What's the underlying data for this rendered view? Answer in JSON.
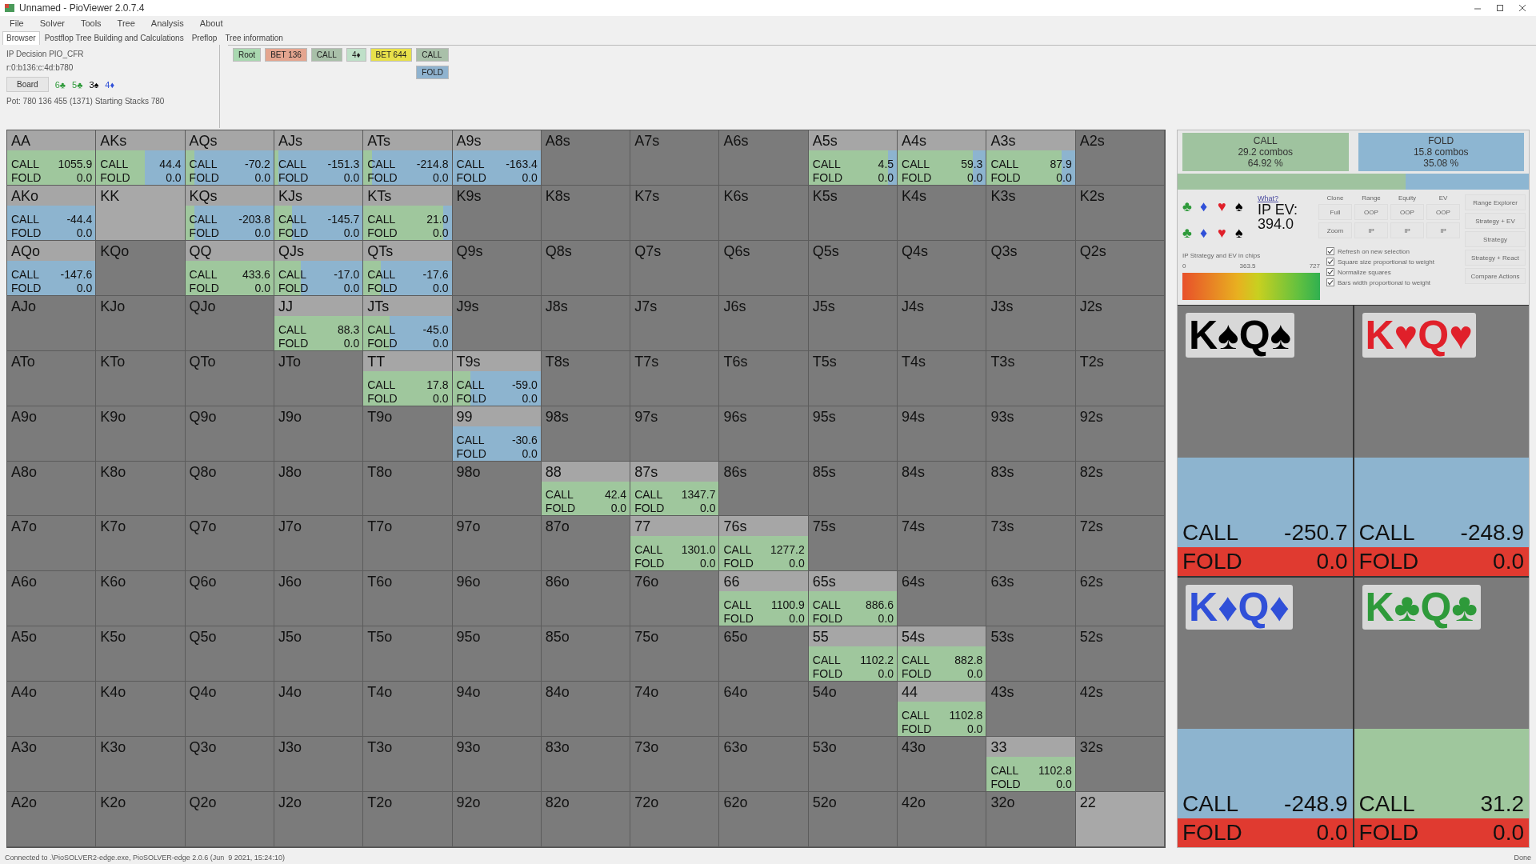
{
  "window": {
    "title": "Unnamed - PioViewer 2.0.7.4"
  },
  "menu": [
    "File",
    "Solver",
    "Tools",
    "Tree",
    "Analysis",
    "About"
  ],
  "tabs": [
    {
      "label": "Browser",
      "selected": true
    },
    {
      "label": "Postflop Tree Building and Calculations",
      "selected": false
    },
    {
      "label": "Preflop",
      "selected": false
    },
    {
      "label": "Tree information",
      "selected": false
    }
  ],
  "info": {
    "decision": "IP Decision   PIO_CFR",
    "line": "r:0:b136:c:4d:b780",
    "board_button": "Board",
    "board": [
      {
        "text": "6♣",
        "color": "#2e9a3a"
      },
      {
        "text": "5♣",
        "color": "#2e9a3a"
      },
      {
        "text": "3♠",
        "color": "#000000"
      },
      {
        "text": "4♦",
        "color": "#3050d8"
      }
    ],
    "pot": "Pot: 780 136 455 (1371) Starting Stacks 780"
  },
  "tree": {
    "path": [
      {
        "label": "Root",
        "color": "#a9d8b0"
      },
      {
        "label": "BET 136",
        "color": "#e4a58f"
      },
      {
        "label": "CALL",
        "color": "#a9c0a9"
      },
      {
        "label": "4♦",
        "color": "#bfe0c8"
      },
      {
        "label": "BET 644",
        "color": "#e8e04a"
      }
    ],
    "options": [
      {
        "label": "CALL",
        "color": "#a9c0a9"
      },
      {
        "label": "FOLD",
        "color": "#8fb3cf"
      }
    ]
  },
  "grid": [
    [
      {
        "kind": "strategy",
        "label": "AA",
        "call_label": "CALL",
        "call": "1055.9",
        "fold_label": "FOLD",
        "fold": "0.0",
        "level": 1
      },
      {
        "kind": "strategy",
        "label": "AKs",
        "call_label": "CALL",
        "call": "44.4",
        "fold_label": "FOLD",
        "fold": "0.0",
        "level": 0.55
      },
      {
        "kind": "strategy",
        "label": "AQs",
        "call_label": "CALL",
        "call": "-70.2",
        "fold_label": "FOLD",
        "fold": "0.0",
        "level": 0.1
      },
      {
        "kind": "strategy",
        "label": "AJs",
        "call_label": "CALL",
        "call": "-151.3",
        "fold_label": "FOLD",
        "fold": "0.0",
        "level": 0.05
      },
      {
        "kind": "strategy",
        "label": "ATs",
        "call_label": "CALL",
        "call": "-214.8",
        "fold_label": "FOLD",
        "fold": "0.0",
        "level": 0.1
      },
      {
        "kind": "strategy",
        "label": "A9s",
        "call_label": "CALL",
        "call": "-163.4",
        "fold_label": "FOLD",
        "fold": "0.0",
        "level": 0
      },
      {
        "kind": "empty",
        "label": "A8s"
      },
      {
        "kind": "empty",
        "label": "A7s"
      },
      {
        "kind": "empty",
        "label": "A6s"
      },
      {
        "kind": "strategy",
        "label": "A5s",
        "call_label": "CALL",
        "call": "4.5",
        "fold_label": "FOLD",
        "fold": "0.0",
        "level": 0.9
      },
      {
        "kind": "strategy",
        "label": "A4s",
        "call_label": "CALL",
        "call": "59.3",
        "fold_label": "FOLD",
        "fold": "0.0",
        "level": 0.85
      },
      {
        "kind": "strategy",
        "label": "A3s",
        "call_label": "CALL",
        "call": "87.9",
        "fold_label": "FOLD",
        "fold": "0.0",
        "level": 0.85
      },
      {
        "kind": "empty",
        "label": "A2s"
      }
    ],
    [
      {
        "kind": "strategy",
        "label": "AKo",
        "call_label": "CALL",
        "call": "-44.4",
        "fold_label": "FOLD",
        "fold": "0.0",
        "level": 0
      },
      {
        "kind": "blocked",
        "label": "KK"
      },
      {
        "kind": "strategy",
        "label": "KQs",
        "call_label": "CALL",
        "call": "-203.8",
        "fold_label": "FOLD",
        "fold": "0.0",
        "level": 0.1
      },
      {
        "kind": "strategy",
        "label": "KJs",
        "call_label": "CALL",
        "call": "-145.7",
        "fold_label": "FOLD",
        "fold": "0.0",
        "level": 0.2
      },
      {
        "kind": "strategy",
        "label": "KTs",
        "call_label": "CALL",
        "call": "21.0",
        "fold_label": "FOLD",
        "fold": "0.0",
        "level": 0.9
      },
      {
        "kind": "empty",
        "label": "K9s"
      },
      {
        "kind": "empty",
        "label": "K8s"
      },
      {
        "kind": "empty",
        "label": "K7s"
      },
      {
        "kind": "empty",
        "label": "K6s"
      },
      {
        "kind": "empty",
        "label": "K5s"
      },
      {
        "kind": "empty",
        "label": "K4s"
      },
      {
        "kind": "empty",
        "label": "K3s"
      },
      {
        "kind": "empty",
        "label": "K2s"
      }
    ],
    [
      {
        "kind": "strategy",
        "label": "AQo",
        "call_label": "CALL",
        "call": "-147.6",
        "fold_label": "FOLD",
        "fold": "0.0",
        "level": 0
      },
      {
        "kind": "empty",
        "label": "KQo"
      },
      {
        "kind": "strategy",
        "label": "QQ",
        "call_label": "CALL",
        "call": "433.6",
        "fold_label": "FOLD",
        "fold": "0.0",
        "level": 1
      },
      {
        "kind": "strategy",
        "label": "QJs",
        "call_label": "CALL",
        "call": "-17.0",
        "fold_label": "FOLD",
        "fold": "0.0",
        "level": 0.3
      },
      {
        "kind": "strategy",
        "label": "QTs",
        "call_label": "CALL",
        "call": "-17.6",
        "fold_label": "FOLD",
        "fold": "0.0",
        "level": 0.2
      },
      {
        "kind": "empty",
        "label": "Q9s"
      },
      {
        "kind": "empty",
        "label": "Q8s"
      },
      {
        "kind": "empty",
        "label": "Q7s"
      },
      {
        "kind": "empty",
        "label": "Q6s"
      },
      {
        "kind": "empty",
        "label": "Q5s"
      },
      {
        "kind": "empty",
        "label": "Q4s"
      },
      {
        "kind": "empty",
        "label": "Q3s"
      },
      {
        "kind": "empty",
        "label": "Q2s"
      }
    ],
    [
      {
        "kind": "empty",
        "label": "AJo"
      },
      {
        "kind": "empty",
        "label": "KJo"
      },
      {
        "kind": "empty",
        "label": "QJo"
      },
      {
        "kind": "strategy",
        "label": "JJ",
        "call_label": "CALL",
        "call": "88.3",
        "fold_label": "FOLD",
        "fold": "0.0",
        "level": 1
      },
      {
        "kind": "strategy",
        "label": "JTs",
        "call_label": "CALL",
        "call": "-45.0",
        "fold_label": "FOLD",
        "fold": "0.0",
        "level": 0.3
      },
      {
        "kind": "empty",
        "label": "J9s"
      },
      {
        "kind": "empty",
        "label": "J8s"
      },
      {
        "kind": "empty",
        "label": "J7s"
      },
      {
        "kind": "empty",
        "label": "J6s"
      },
      {
        "kind": "empty",
        "label": "J5s"
      },
      {
        "kind": "empty",
        "label": "J4s"
      },
      {
        "kind": "empty",
        "label": "J3s"
      },
      {
        "kind": "empty",
        "label": "J2s"
      }
    ],
    [
      {
        "kind": "empty",
        "label": "ATo"
      },
      {
        "kind": "empty",
        "label": "KTo"
      },
      {
        "kind": "empty",
        "label": "QTo"
      },
      {
        "kind": "empty",
        "label": "JTo"
      },
      {
        "kind": "strategy",
        "label": "TT",
        "call_label": "CALL",
        "call": "17.8",
        "fold_label": "FOLD",
        "fold": "0.0",
        "level": 1
      },
      {
        "kind": "strategy",
        "label": "T9s",
        "call_label": "CALL",
        "call": "-59.0",
        "fold_label": "FOLD",
        "fold": "0.0",
        "level": 0.2
      },
      {
        "kind": "empty",
        "label": "T8s"
      },
      {
        "kind": "empty",
        "label": "T7s"
      },
      {
        "kind": "empty",
        "label": "T6s"
      },
      {
        "kind": "empty",
        "label": "T5s"
      },
      {
        "kind": "empty",
        "label": "T4s"
      },
      {
        "kind": "empty",
        "label": "T3s"
      },
      {
        "kind": "empty",
        "label": "T2s"
      }
    ],
    [
      {
        "kind": "empty",
        "label": "A9o"
      },
      {
        "kind": "empty",
        "label": "K9o"
      },
      {
        "kind": "empty",
        "label": "Q9o"
      },
      {
        "kind": "empty",
        "label": "J9o"
      },
      {
        "kind": "empty",
        "label": "T9o"
      },
      {
        "kind": "strategy",
        "label": "99",
        "call_label": "CALL",
        "call": "-30.6",
        "fold_label": "FOLD",
        "fold": "0.0",
        "level": 0
      },
      {
        "kind": "empty",
        "label": "98s"
      },
      {
        "kind": "empty",
        "label": "97s"
      },
      {
        "kind": "empty",
        "label": "96s"
      },
      {
        "kind": "empty",
        "label": "95s"
      },
      {
        "kind": "empty",
        "label": "94s"
      },
      {
        "kind": "empty",
        "label": "93s"
      },
      {
        "kind": "empty",
        "label": "92s"
      }
    ],
    [
      {
        "kind": "empty",
        "label": "A8o"
      },
      {
        "kind": "empty",
        "label": "K8o"
      },
      {
        "kind": "empty",
        "label": "Q8o"
      },
      {
        "kind": "empty",
        "label": "J8o"
      },
      {
        "kind": "empty",
        "label": "T8o"
      },
      {
        "kind": "empty",
        "label": "98o"
      },
      {
        "kind": "strategy",
        "label": "88",
        "call_label": "CALL",
        "call": "42.4",
        "fold_label": "FOLD",
        "fold": "0.0",
        "level": 1
      },
      {
        "kind": "strategy",
        "label": "87s",
        "call_label": "CALL",
        "call": "1347.7",
        "fold_label": "FOLD",
        "fold": "0.0",
        "level": 1
      },
      {
        "kind": "empty",
        "label": "86s"
      },
      {
        "kind": "empty",
        "label": "85s"
      },
      {
        "kind": "empty",
        "label": "84s"
      },
      {
        "kind": "empty",
        "label": "83s"
      },
      {
        "kind": "empty",
        "label": "82s"
      }
    ],
    [
      {
        "kind": "empty",
        "label": "A7o"
      },
      {
        "kind": "empty",
        "label": "K7o"
      },
      {
        "kind": "empty",
        "label": "Q7o"
      },
      {
        "kind": "empty",
        "label": "J7o"
      },
      {
        "kind": "empty",
        "label": "T7o"
      },
      {
        "kind": "empty",
        "label": "97o"
      },
      {
        "kind": "empty",
        "label": "87o"
      },
      {
        "kind": "strategy",
        "label": "77",
        "call_label": "CALL",
        "call": "1301.0",
        "fold_label": "FOLD",
        "fold": "0.0",
        "level": 1
      },
      {
        "kind": "strategy",
        "label": "76s",
        "call_label": "CALL",
        "call": "1277.2",
        "fold_label": "FOLD",
        "fold": "0.0",
        "level": 1
      },
      {
        "kind": "empty",
        "label": "75s"
      },
      {
        "kind": "empty",
        "label": "74s"
      },
      {
        "kind": "empty",
        "label": "73s"
      },
      {
        "kind": "empty",
        "label": "72s"
      }
    ],
    [
      {
        "kind": "empty",
        "label": "A6o"
      },
      {
        "kind": "empty",
        "label": "K6o"
      },
      {
        "kind": "empty",
        "label": "Q6o"
      },
      {
        "kind": "empty",
        "label": "J6o"
      },
      {
        "kind": "empty",
        "label": "T6o"
      },
      {
        "kind": "empty",
        "label": "96o"
      },
      {
        "kind": "empty",
        "label": "86o"
      },
      {
        "kind": "empty",
        "label": "76o"
      },
      {
        "kind": "strategy",
        "label": "66",
        "call_label": "CALL",
        "call": "1100.9",
        "fold_label": "FOLD",
        "fold": "0.0",
        "level": 1
      },
      {
        "kind": "strategy",
        "label": "65s",
        "call_label": "CALL",
        "call": "886.6",
        "fold_label": "FOLD",
        "fold": "0.0",
        "level": 1
      },
      {
        "kind": "empty",
        "label": "64s"
      },
      {
        "kind": "empty",
        "label": "63s"
      },
      {
        "kind": "empty",
        "label": "62s"
      }
    ],
    [
      {
        "kind": "empty",
        "label": "A5o"
      },
      {
        "kind": "empty",
        "label": "K5o"
      },
      {
        "kind": "empty",
        "label": "Q5o"
      },
      {
        "kind": "empty",
        "label": "J5o"
      },
      {
        "kind": "empty",
        "label": "T5o"
      },
      {
        "kind": "empty",
        "label": "95o"
      },
      {
        "kind": "empty",
        "label": "85o"
      },
      {
        "kind": "empty",
        "label": "75o"
      },
      {
        "kind": "empty",
        "label": "65o"
      },
      {
        "kind": "strategy",
        "label": "55",
        "call_label": "CALL",
        "call": "1102.2",
        "fold_label": "FOLD",
        "fold": "0.0",
        "level": 1
      },
      {
        "kind": "strategy",
        "label": "54s",
        "call_label": "CALL",
        "call": "882.8",
        "fold_label": "FOLD",
        "fold": "0.0",
        "level": 1
      },
      {
        "kind": "empty",
        "label": "53s"
      },
      {
        "kind": "empty",
        "label": "52s"
      }
    ],
    [
      {
        "kind": "empty",
        "label": "A4o"
      },
      {
        "kind": "empty",
        "label": "K4o"
      },
      {
        "kind": "empty",
        "label": "Q4o"
      },
      {
        "kind": "empty",
        "label": "J4o"
      },
      {
        "kind": "empty",
        "label": "T4o"
      },
      {
        "kind": "empty",
        "label": "94o"
      },
      {
        "kind": "empty",
        "label": "84o"
      },
      {
        "kind": "empty",
        "label": "74o"
      },
      {
        "kind": "empty",
        "label": "64o"
      },
      {
        "kind": "empty",
        "label": "54o"
      },
      {
        "kind": "strategy",
        "label": "44",
        "call_label": "CALL",
        "call": "1102.8",
        "fold_label": "FOLD",
        "fold": "0.0",
        "level": 1
      },
      {
        "kind": "empty",
        "label": "43s"
      },
      {
        "kind": "empty",
        "label": "42s"
      }
    ],
    [
      {
        "kind": "empty",
        "label": "A3o"
      },
      {
        "kind": "empty",
        "label": "K3o"
      },
      {
        "kind": "empty",
        "label": "Q3o"
      },
      {
        "kind": "empty",
        "label": "J3o"
      },
      {
        "kind": "empty",
        "label": "T3o"
      },
      {
        "kind": "empty",
        "label": "93o"
      },
      {
        "kind": "empty",
        "label": "83o"
      },
      {
        "kind": "empty",
        "label": "73o"
      },
      {
        "kind": "empty",
        "label": "63o"
      },
      {
        "kind": "empty",
        "label": "53o"
      },
      {
        "kind": "empty",
        "label": "43o"
      },
      {
        "kind": "strategy",
        "label": "33",
        "call_label": "CALL",
        "call": "1102.8",
        "fold_label": "FOLD",
        "fold": "0.0",
        "level": 1
      },
      {
        "kind": "empty",
        "label": "32s"
      }
    ],
    [
      {
        "kind": "empty",
        "label": "A2o"
      },
      {
        "kind": "empty",
        "label": "K2o"
      },
      {
        "kind": "empty",
        "label": "Q2o"
      },
      {
        "kind": "empty",
        "label": "J2o"
      },
      {
        "kind": "empty",
        "label": "T2o"
      },
      {
        "kind": "empty",
        "label": "92o"
      },
      {
        "kind": "empty",
        "label": "82o"
      },
      {
        "kind": "empty",
        "label": "72o"
      },
      {
        "kind": "empty",
        "label": "62o"
      },
      {
        "kind": "empty",
        "label": "52o"
      },
      {
        "kind": "empty",
        "label": "42o"
      },
      {
        "kind": "empty",
        "label": "32o"
      },
      {
        "kind": "blocked",
        "label": "22"
      }
    ]
  ],
  "summary": {
    "actions": [
      {
        "label": "CALL",
        "combos": "29.2 combos",
        "percent": "64.92 %",
        "color": "#9fc39f"
      },
      {
        "label": "FOLD",
        "combos": "15.8 combos",
        "percent": "35.08 %",
        "color": "#8db6d2"
      }
    ],
    "level": 0.65
  },
  "suit_filters": [
    [
      {
        "text": "♣",
        "color": "#2e9a3a"
      },
      {
        "text": "♦",
        "color": "#3050d8"
      },
      {
        "text": "♥",
        "color": "#e0202a"
      },
      {
        "text": "♠",
        "color": "#000000"
      }
    ],
    [
      {
        "text": "♣",
        "color": "#2e9a3a"
      },
      {
        "text": "♦",
        "color": "#3050d8"
      },
      {
        "text": "♥",
        "color": "#e0202a"
      },
      {
        "text": "♠",
        "color": "#000000"
      }
    ]
  ],
  "what_link": "What?",
  "ev_label": "IP EV:",
  "ev_value": "394.0",
  "button_groups": [
    {
      "heading": "Clone",
      "buttons": [
        "Full",
        "Zoom"
      ]
    },
    {
      "heading": "Range",
      "buttons": [
        "OOP",
        "IP"
      ]
    },
    {
      "heading": "Equity",
      "buttons": [
        "OOP",
        "IP"
      ]
    },
    {
      "heading": "EV",
      "buttons": [
        "OOP",
        "IP"
      ]
    }
  ],
  "view_buttons": [
    "Range Explorer",
    "Strategy + EV",
    "Strategy",
    "Strategy + React",
    "Compare Actions"
  ],
  "scale": {
    "caption": "IP Strategy and EV in chips",
    "ticks": [
      "0",
      "363.5",
      "727"
    ]
  },
  "options": [
    {
      "label": "Refresh on new selection",
      "checked": true
    },
    {
      "label": "Square size proportional to weight",
      "checked": true
    },
    {
      "label": "Normalize squares",
      "checked": true
    },
    {
      "label": "Bars width proportional to weight",
      "checked": true
    }
  ],
  "combos": [
    {
      "cards": "K♠Q♠",
      "color": "#000000",
      "call_label": "CALL",
      "call": "-250.7",
      "fold_label": "FOLD",
      "fold": "0.0",
      "level": 0
    },
    {
      "cards": "K♥Q♥",
      "color": "#e0202a",
      "call_label": "CALL",
      "call": "-248.9",
      "fold_label": "FOLD",
      "fold": "0.0",
      "level": 0
    },
    {
      "cards": "K♦Q♦",
      "color": "#3050d8",
      "call_label": "CALL",
      "call": "-248.9",
      "fold_label": "FOLD",
      "fold": "0.0",
      "level": 0
    },
    {
      "cards": "K♣Q♣",
      "color": "#2e9a3a",
      "call_label": "CALL",
      "call": "31.2",
      "fold_label": "FOLD",
      "fold": "0.0",
      "level": 1
    }
  ],
  "status": {
    "message": "Connected to .\\PioSOLVER2-edge.exe, PioSOLVER-edge 2.0.6 (Jun  9 2021, 15:24:10)",
    "state": "Done"
  }
}
